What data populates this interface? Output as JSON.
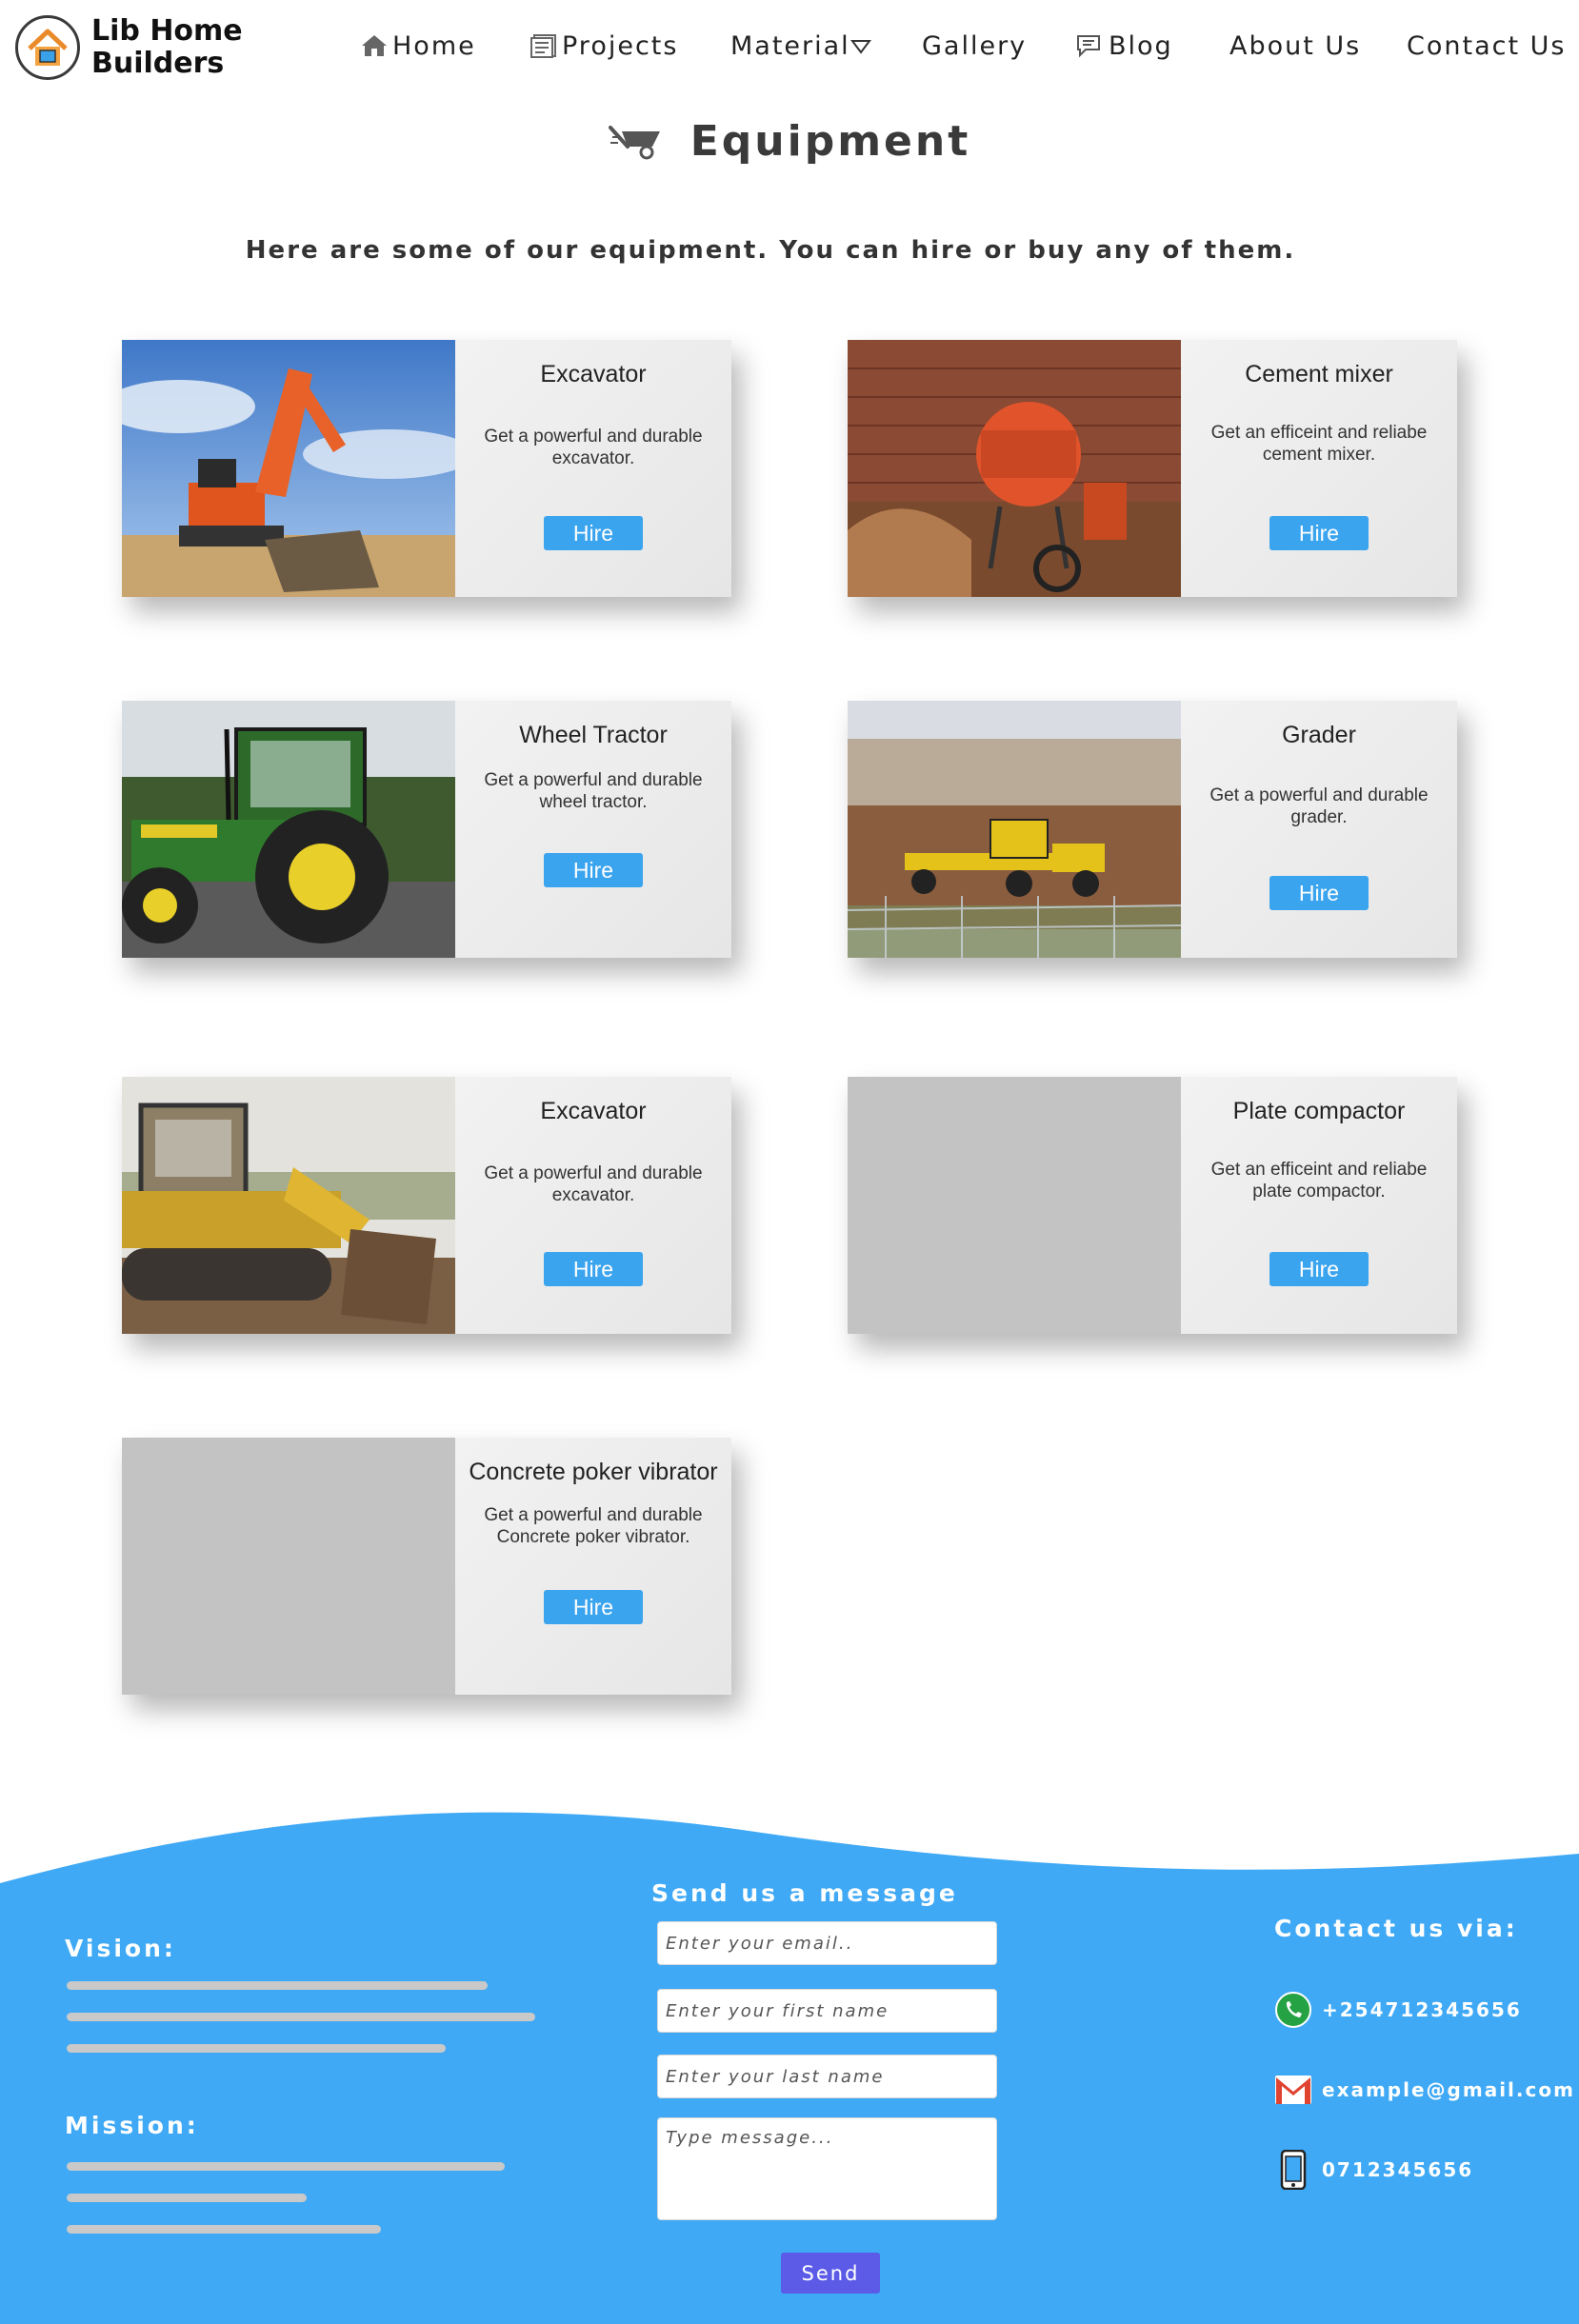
{
  "header": {
    "logo_line1": "Lib Home",
    "logo_line2": "Builders",
    "nav": {
      "home": "Home",
      "projects": "Projects",
      "material": "Material",
      "gallery": "Gallery",
      "blog": "Blog",
      "about": "About Us",
      "contact": "Contact Us"
    }
  },
  "main": {
    "title": "Equipment",
    "title_icon": "wheelbarrow-icon",
    "intro": "Here are some of our equipment. You can hire or buy any of them.",
    "cards": [
      {
        "title": "Excavator",
        "description": "Get a powerful and durable excavator.",
        "button": "Hire",
        "image": "excavator-photo"
      },
      {
        "title": "Cement mixer",
        "description": "Get an efficeint and reliabe cement mixer.",
        "button": "Hire",
        "image": "cement-mixer-photo"
      },
      {
        "title": "Wheel Tractor",
        "description": "Get a powerful and durable wheel tractor.",
        "button": "Hire",
        "image": "tractor-photo"
      },
      {
        "title": "Grader",
        "description": "Get a powerful and durable grader.",
        "button": "Hire",
        "image": "grader-photo"
      },
      {
        "title": "Excavator",
        "description": "Get a powerful and durable excavator.",
        "button": "Hire",
        "image": "bulldozer-photo"
      },
      {
        "title": "Plate compactor",
        "description": "Get an efficeint and reliabe plate compactor.",
        "button": "Hire",
        "image": "image-placeholder"
      },
      {
        "title": "Concrete poker vibrator",
        "description": "Get a powerful and durable Concrete poker vibrator.",
        "button": "Hire",
        "image": "image-placeholder"
      }
    ]
  },
  "footer": {
    "vision_heading": "Vision:",
    "mission_heading": "Mission:",
    "form_heading": "Send us a message",
    "email_placeholder": "Enter your email..",
    "first_name_placeholder": "Enter your first name",
    "last_name_placeholder": "Enter your last name",
    "message_placeholder": "Type message...",
    "send_label": "Send",
    "contact_heading": "Contact us via:",
    "phone_whatsapp": "+254712345656",
    "email": "example@gmail.com",
    "phone": "0712345656"
  },
  "colors": {
    "accent": "#3ba4ee",
    "footer_bg": "#3fa9f5",
    "send_button": "#5b5be8",
    "placeholder_line": "#c9c9c9"
  }
}
